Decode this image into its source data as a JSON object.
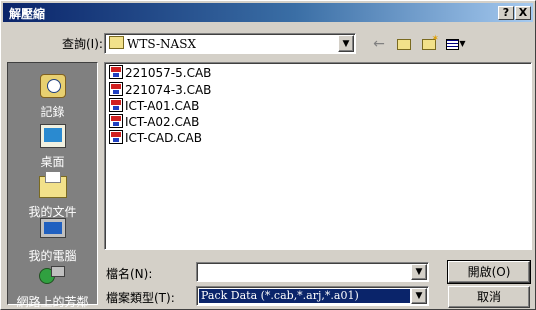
{
  "window": {
    "title": "解壓縮",
    "help_button": "?",
    "close_button": "X"
  },
  "lookin": {
    "label": "查詢(I):",
    "folder": "WTS-NASX"
  },
  "toolbar": [
    {
      "name": "back-icon",
      "glyph": "←"
    },
    {
      "name": "up-folder-icon",
      "glyph": "🗂"
    },
    {
      "name": "new-folder-icon",
      "glyph": "📂"
    },
    {
      "name": "view-menu-icon",
      "glyph": "▦▾"
    }
  ],
  "places": [
    {
      "label": "記錄",
      "icon": "history-icon"
    },
    {
      "label": "桌面",
      "icon": "desktop-icon"
    },
    {
      "label": "我的文件",
      "icon": "my-documents-icon"
    },
    {
      "label": "我的電腦",
      "icon": "my-computer-icon"
    },
    {
      "label": "網路上的芳鄰",
      "icon": "network-places-icon"
    }
  ],
  "files": [
    "221057-5.CAB",
    "221074-3.CAB",
    "ICT-A01.CAB",
    "ICT-A02.CAB",
    "ICT-CAD.CAB"
  ],
  "filename": {
    "label": "檔名(N):",
    "value": ""
  },
  "filetype": {
    "label": "檔案類型(T):",
    "value": "Pack Data (*.cab,*.arj,*.a01)"
  },
  "buttons": {
    "open": "開啟(O)",
    "cancel": "取消"
  }
}
